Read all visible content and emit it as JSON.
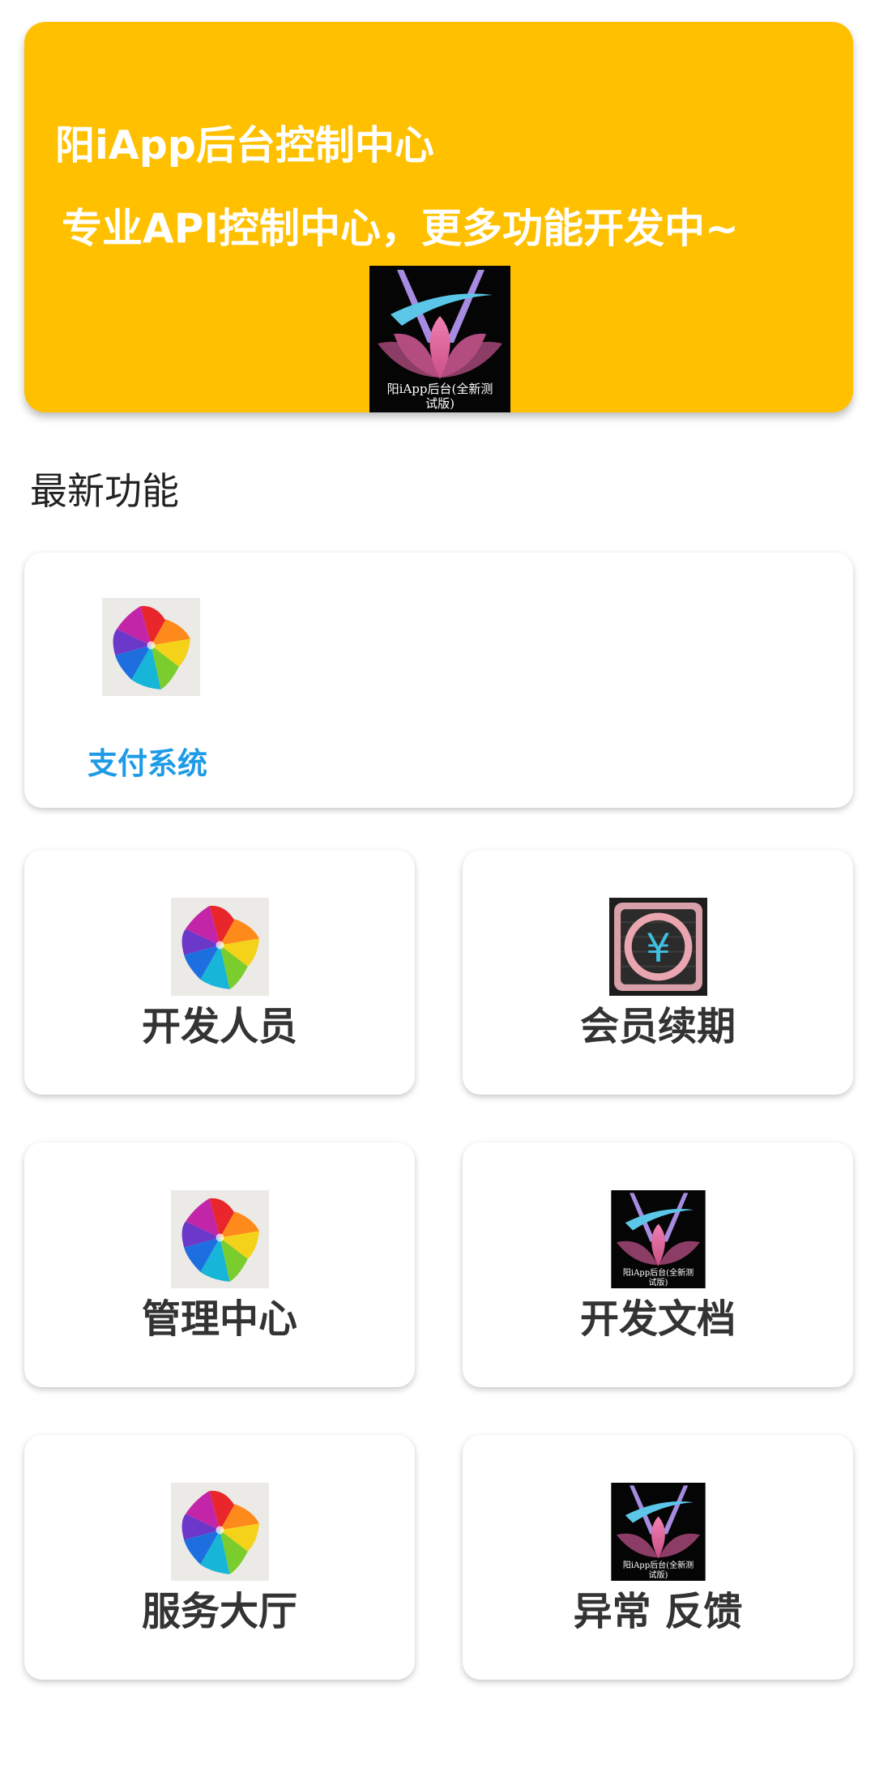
{
  "banner": {
    "title": "阳iApp后台控制中心",
    "subtitle": "专业API控制中心，更多功能开发中~",
    "background_color": "#ffc000",
    "logo": {
      "icon": "lotus-logo-icon",
      "caption_line1": "阳iApp后台(全新测",
      "caption_line2": "试版)"
    }
  },
  "section": {
    "title": "最新功能"
  },
  "featured": {
    "label": "支付系统",
    "icon": "pinwheel-star-icon",
    "label_color": "#1e9be6"
  },
  "tiles": [
    {
      "label": "开发人员",
      "icon": "pinwheel-star-icon"
    },
    {
      "label": "会员续期",
      "icon": "yen-ring-icon"
    },
    {
      "label": "管理中心",
      "icon": "pinwheel-star-icon"
    },
    {
      "label": "开发文档",
      "icon": "lotus-logo-icon",
      "caption_line1": "阳iApp后台(全新测",
      "caption_line2": "试版)"
    },
    {
      "label": "服务大厅",
      "icon": "pinwheel-star-icon"
    },
    {
      "label": "异常 反馈",
      "icon": "lotus-logo-icon",
      "caption_line1": "阳iApp后台(全新测",
      "caption_line2": "试版)"
    }
  ]
}
